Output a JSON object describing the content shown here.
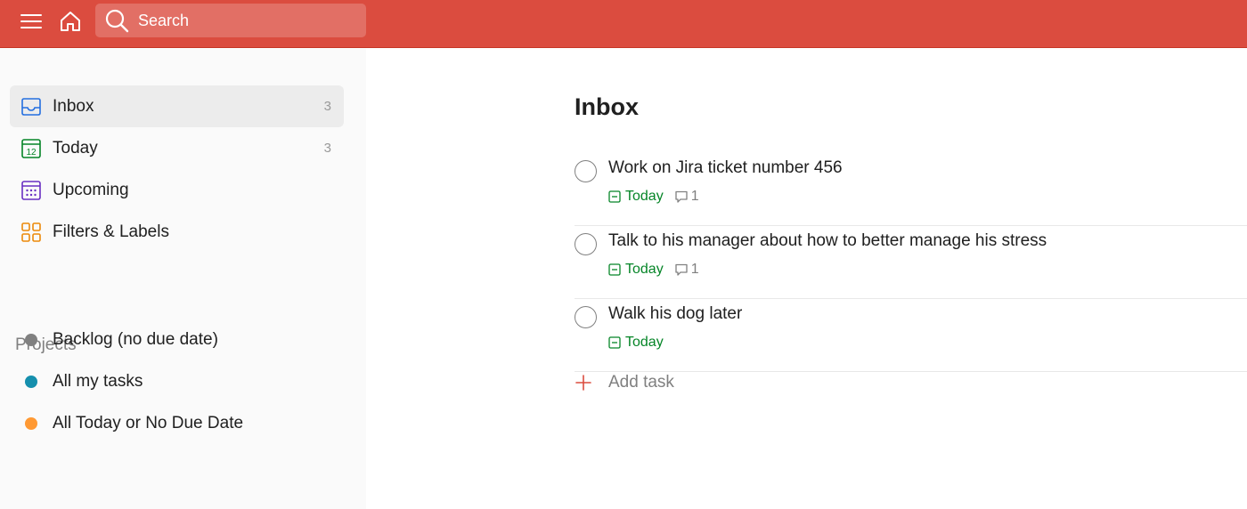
{
  "topbar": {
    "search_placeholder": "Search",
    "icons": [
      "menu-icon",
      "home-icon",
      "search-icon"
    ],
    "color": "#db4c3f"
  },
  "sidebar": {
    "items": [
      {
        "label": "Inbox",
        "count": "3",
        "icon": "inbox-icon",
        "active": true
      },
      {
        "label": "Today",
        "count": "3",
        "icon": "calendar-today-icon"
      },
      {
        "label": "Upcoming",
        "count": "",
        "icon": "calendar-upcoming-icon"
      },
      {
        "label": "Filters & Labels",
        "count": "",
        "icon": "filters-labels-icon"
      }
    ],
    "projects_title": "Projects",
    "projects": [
      {
        "label": "Backlog (no due date)",
        "color": "#808080"
      },
      {
        "label": "All my tasks",
        "color": "#158fad"
      },
      {
        "label": "All Today or No Due Date",
        "color": "#ff9933"
      }
    ]
  },
  "main": {
    "title": "Inbox",
    "tasks": [
      {
        "name": "Work on Jira ticket number 456",
        "due": "Today",
        "comments": "1"
      },
      {
        "name": "Talk to his manager about how to better manage his stress",
        "due": "Today",
        "comments": "1"
      },
      {
        "name": "Walk his dog later",
        "due": "Today",
        "comments": ""
      }
    ],
    "add_task_label": "Add task"
  },
  "colors": {
    "accent": "#db4c3f",
    "due_green": "#058527",
    "inbox_blue": "#246fe0",
    "today_green": "#058527",
    "upcoming_purple": "#692fc2",
    "filters_orange": "#eb8909"
  }
}
